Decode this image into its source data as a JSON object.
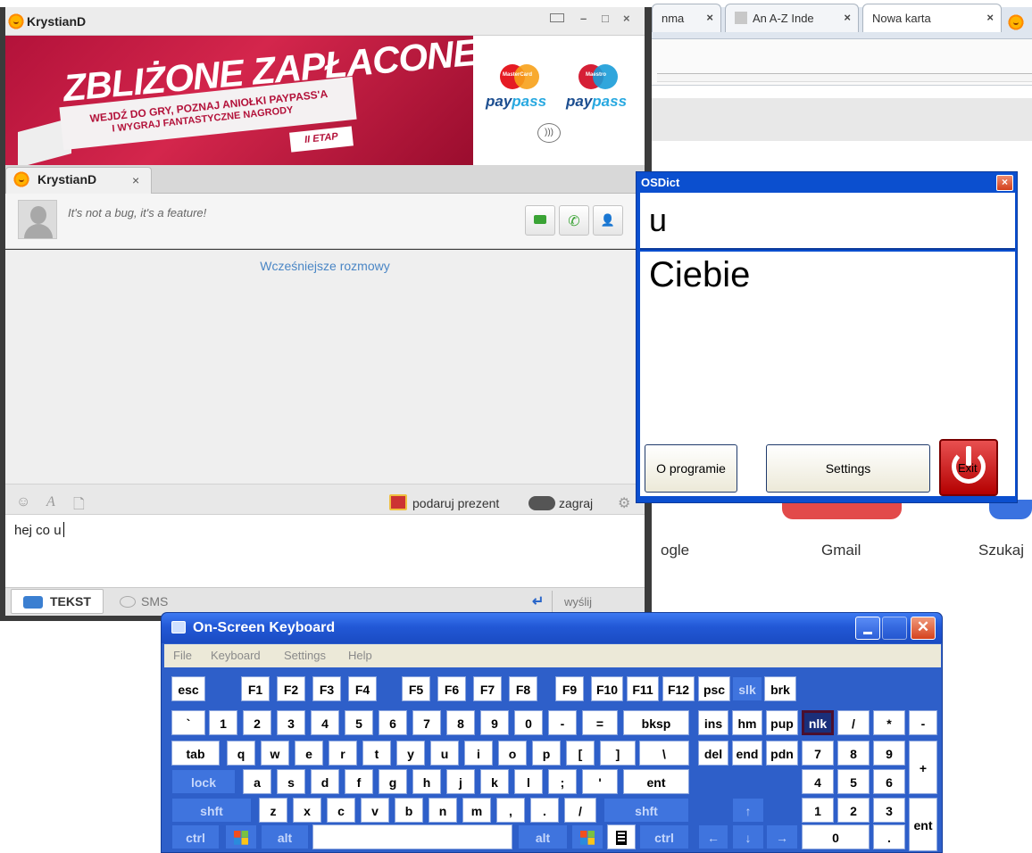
{
  "browser": {
    "tabs": [
      {
        "label": "nma",
        "close": "×"
      },
      {
        "label": "An A-Z Inde",
        "close": "×"
      },
      {
        "label": "Nowa karta",
        "close": "×"
      }
    ],
    "ntp_tiles": [
      "ogle",
      "Gmail",
      "Szukaj"
    ]
  },
  "messenger": {
    "title": "KrystianD",
    "window_controls": {
      "min": "–",
      "max": "□",
      "close": "×"
    },
    "ad": {
      "headline": "ZBLIŻONE ZAPŁACONE",
      "subline1": "WEJDŹ DO GRY, POZNAJ ANIOŁKI PAYPASS'A",
      "subline2": "I WYGRAJ FANTASTYCZNE NAGRODY",
      "stage": "II ETAP",
      "brand1_label": "MasterCard",
      "brand2_label": "Maestro",
      "paypass_a": "pay",
      "paypass_b": "pass"
    },
    "tab": {
      "label": "KrystianD",
      "close": "×"
    },
    "contact": {
      "status": "It's not a bug, it's a feature!"
    },
    "history_link": "Wcześniejsze rozmowy",
    "toolbar": {
      "gift_label": "podaruj prezent",
      "game_label": "zagraj"
    },
    "input_text": "hej co u",
    "bottom": {
      "tekst_label": "TEKST",
      "sms_label": "SMS",
      "send_label": "wyślij"
    }
  },
  "osdict": {
    "title": "OSDict",
    "close": "×",
    "input_word": "u",
    "translation": "Ciebie",
    "buttons": {
      "about": "O programie",
      "settings": "Settings",
      "exit": "Exit"
    }
  },
  "osk": {
    "title": "On-Screen Keyboard",
    "menu": [
      "File",
      "Keyboard",
      "Settings",
      "Help"
    ],
    "keys": {
      "esc": "esc",
      "f1": "F1",
      "f2": "F2",
      "f3": "F3",
      "f4": "F4",
      "f5": "F5",
      "f6": "F6",
      "f7": "F7",
      "f8": "F8",
      "f9": "F9",
      "f10": "F10",
      "f11": "F11",
      "f12": "F12",
      "psc": "psc",
      "slk": "slk",
      "brk": "brk",
      "grave": "`",
      "n1": "1",
      "n2": "2",
      "n3": "3",
      "n4": "4",
      "n5": "5",
      "n6": "6",
      "n7": "7",
      "n8": "8",
      "n9": "9",
      "n0": "0",
      "minus": "-",
      "equals": "=",
      "bksp": "bksp",
      "ins": "ins",
      "hm": "hm",
      "pup": "pup",
      "nlk": "nlk",
      "kp_div": "/",
      "kp_mul": "*",
      "kp_sub": "-",
      "tab": "tab",
      "q": "q",
      "w": "w",
      "e": "e",
      "r": "r",
      "t": "t",
      "y": "y",
      "u": "u",
      "i": "i",
      "o": "o",
      "p": "p",
      "lbr": "[",
      "rbr": "]",
      "bslash": "\\",
      "del": "del",
      "end": "end",
      "pdn": "pdn",
      "kp7": "7",
      "kp8": "8",
      "kp9": "9",
      "kp_add": "+",
      "lock": "lock",
      "a": "a",
      "s": "s",
      "d": "d",
      "f": "f",
      "g": "g",
      "h": "h",
      "j": "j",
      "k": "k",
      "l": "l",
      "semi": ";",
      "quote": "'",
      "ent": "ent",
      "kp4": "4",
      "kp5": "5",
      "kp6": "6",
      "lshft": "shft",
      "z": "z",
      "x": "x",
      "c": "c",
      "v": "v",
      "b": "b",
      "n": "n",
      "m": "m",
      "comma": ",",
      "period": ".",
      "slash": "/",
      "rshft": "shft",
      "up": "↑",
      "kp1": "1",
      "kp2": "2",
      "kp3": "3",
      "kp_ent": "ent",
      "lctrl": "ctrl",
      "lalt": "alt",
      "ralt": "alt",
      "rctrl": "ctrl",
      "left": "←",
      "down": "↓",
      "right": "→",
      "kp0": "0",
      "kp_dot": "."
    }
  }
}
